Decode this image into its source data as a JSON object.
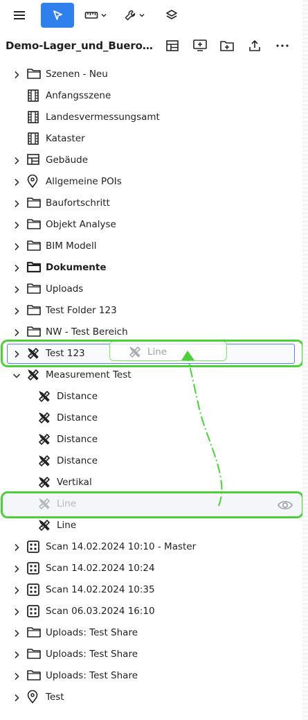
{
  "toolbar": {
    "menu_icon": "hamburger-menu-icon",
    "select_icon": "cursor-pointer-icon",
    "measure_icon": "ruler-icon",
    "tools_icon": "wrench-icon",
    "layers_icon": "layers-icon",
    "active_color": "#2f80ed"
  },
  "header": {
    "project_title": "Demo-Lager_und_Bueroge...",
    "actions": [
      "layout-icon",
      "monitor-add-icon",
      "folder-add-icon",
      "upload-icon",
      "more-icon"
    ]
  },
  "tree": [
    {
      "label": "Szenen - Neu",
      "icon": "folder-icon",
      "expandable": true,
      "level": 0
    },
    {
      "label": "Anfangsszene",
      "icon": "scene-icon",
      "expandable": false,
      "level": 0
    },
    {
      "label": "Landesvermessungsamt",
      "icon": "scene-icon",
      "expandable": false,
      "level": 0
    },
    {
      "label": "Kataster",
      "icon": "scene-icon",
      "expandable": false,
      "level": 0
    },
    {
      "label": "Gebäude",
      "icon": "layout-icon",
      "expandable": true,
      "level": 0
    },
    {
      "label": "Allgemeine POIs",
      "icon": "pin-icon",
      "expandable": true,
      "level": 0
    },
    {
      "label": "Baufortschritt",
      "icon": "folder-icon",
      "expandable": true,
      "level": 0
    },
    {
      "label": "Objekt Analyse",
      "icon": "folder-icon",
      "expandable": true,
      "level": 0
    },
    {
      "label": "BIM Modell",
      "icon": "folder-icon",
      "expandable": true,
      "level": 0
    },
    {
      "label": "Dokumente",
      "icon": "folder-filled-icon",
      "expandable": true,
      "level": 0,
      "bold": true
    },
    {
      "label": "Uploads",
      "icon": "folder-icon",
      "expandable": true,
      "level": 0
    },
    {
      "label": "Test Folder 123",
      "icon": "folder-icon",
      "expandable": true,
      "level": 0
    },
    {
      "label": "NW - Test Bereich",
      "icon": "folder-icon",
      "expandable": true,
      "level": 0
    },
    {
      "label": "Test 123",
      "icon": "measure-tools-icon",
      "expandable": true,
      "level": 0
    },
    {
      "label": "Measurement Test",
      "icon": "measure-tools-icon",
      "expandable": true,
      "expanded": true,
      "level": 0
    },
    {
      "label": "Distance",
      "icon": "measure-tools-icon",
      "expandable": false,
      "level": 1
    },
    {
      "label": "Distance",
      "icon": "measure-tools-icon",
      "expandable": false,
      "level": 1
    },
    {
      "label": "Distance",
      "icon": "measure-tools-icon",
      "expandable": false,
      "level": 1
    },
    {
      "label": "Distance",
      "icon": "measure-tools-icon",
      "expandable": false,
      "level": 1
    },
    {
      "label": "Vertikal",
      "icon": "measure-tools-icon",
      "expandable": false,
      "level": 1
    },
    {
      "label": "Line",
      "icon": "measure-tools-icon",
      "expandable": false,
      "level": 1,
      "ghost": true
    },
    {
      "label": "Line",
      "icon": "measure-tools-icon",
      "expandable": false,
      "level": 1
    },
    {
      "label": "Scan 14.02.2024 10:10 - Master",
      "icon": "grid-icon",
      "expandable": true,
      "level": 0
    },
    {
      "label": "Scan 14.02.2024 10:24",
      "icon": "grid-icon",
      "expandable": true,
      "level": 0
    },
    {
      "label": "Scan 14.02.2024 10:35",
      "icon": "grid-icon",
      "expandable": true,
      "level": 0
    },
    {
      "label": "Scan 06.03.2024 16:10",
      "icon": "grid-icon",
      "expandable": true,
      "level": 0
    },
    {
      "label": "Uploads: Test Share",
      "icon": "folder-icon",
      "expandable": true,
      "level": 0
    },
    {
      "label": "Uploads: Test Share",
      "icon": "folder-icon",
      "expandable": true,
      "level": 0
    },
    {
      "label": "Uploads: Test Share",
      "icon": "folder-icon",
      "expandable": true,
      "level": 0
    },
    {
      "label": "Test",
      "icon": "pin-icon",
      "expandable": true,
      "level": 0
    }
  ],
  "drag_preview": {
    "label": "Line",
    "icon": "measure-tools-icon"
  },
  "ghost_row_action_icon": "eye-icon",
  "annotation_color": "#4cd03a",
  "drop_target_color": "#5b7de6"
}
